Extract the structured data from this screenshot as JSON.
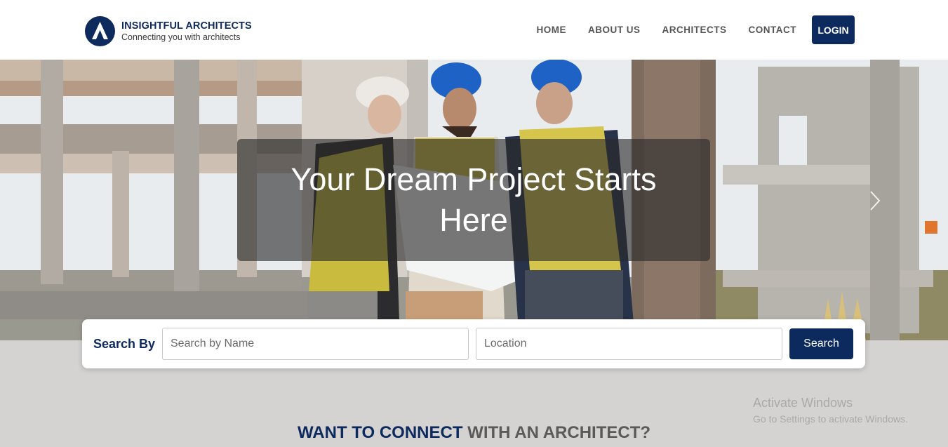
{
  "header": {
    "brand_name": "INSIGHTFUL ARCHITECTS",
    "brand_tagline": "Connecting you with architects",
    "nav": [
      {
        "label": "HOME"
      },
      {
        "label": "ABOUT US"
      },
      {
        "label": "ARCHITECTS"
      },
      {
        "label": "CONTACT"
      }
    ],
    "login_label": "LOGIN"
  },
  "hero": {
    "headline": "Your Dream Project Starts Here"
  },
  "search": {
    "label": "Search By",
    "name_placeholder": "Search by Name",
    "name_value": "",
    "location_placeholder": "Location",
    "location_value": "",
    "button_label": "Search"
  },
  "section": {
    "heading_strong": "WANT TO CONNECT",
    "heading_rest": " WITH AN ARCHITECT?"
  },
  "windows_watermark": {
    "title": "Activate Windows",
    "subtitle": "Go to Settings to activate Windows."
  },
  "colors": {
    "brand_navy": "#0d2a5e",
    "page_bg": "#d4d3d2"
  }
}
